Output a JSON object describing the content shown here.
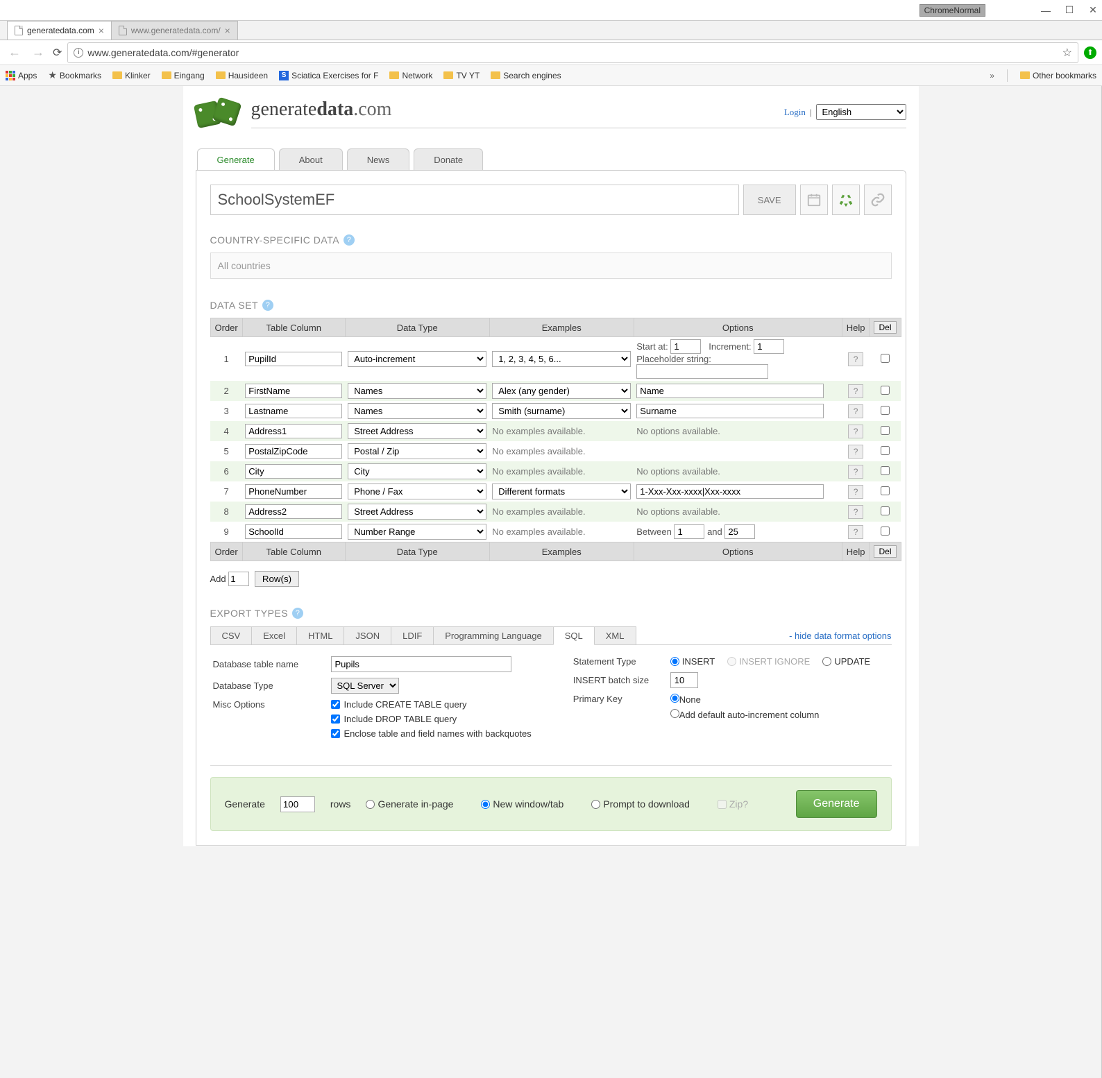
{
  "browser": {
    "badge": "ChromeNormal",
    "tabs": [
      {
        "title": "generatedata.com",
        "active": true
      },
      {
        "title": "www.generatedata.com/",
        "active": false
      }
    ],
    "url": "www.generatedata.com/#generator",
    "bookmarks": {
      "apps": "Apps",
      "bookmarks": "Bookmarks",
      "items": [
        "Klinker",
        "Eingang",
        "Hausideen",
        "Sciatica Exercises for F",
        "Network",
        "TV YT",
        "Search engines"
      ],
      "other": "Other bookmarks"
    }
  },
  "header": {
    "brand1": "generate",
    "brand2": "data",
    "brand3": ".com",
    "login": "Login",
    "lang": "English"
  },
  "main_tabs": [
    "Generate",
    "About",
    "News",
    "Donate"
  ],
  "title_input": "SchoolSystemEF",
  "save_label": "SAVE",
  "sections": {
    "country": "COUNTRY-SPECIFIC DATA",
    "country_value": "All countries",
    "dataset": "DATA SET",
    "export": "EXPORT TYPES"
  },
  "ds_headers": {
    "order": "Order",
    "column": "Table Column",
    "type": "Data Type",
    "examples": "Examples",
    "options": "Options",
    "help": "Help",
    "del": "Del"
  },
  "rows": [
    {
      "n": "1",
      "col": "PupilId",
      "type": "Auto-increment",
      "example": "1, 2, 3, 4, 5, 6...",
      "opts": {
        "kind": "autoinc",
        "start_label": "Start at:",
        "start": "1",
        "incr_label": "Increment:",
        "incr": "1",
        "ph_label": "Placeholder string:",
        "ph": ""
      }
    },
    {
      "n": "2",
      "col": "FirstName",
      "type": "Names",
      "example": "Alex (any gender)",
      "opts": {
        "kind": "text",
        "value": "Name"
      }
    },
    {
      "n": "3",
      "col": "Lastname",
      "type": "Names",
      "example": "Smith (surname)",
      "opts": {
        "kind": "text",
        "value": "Surname"
      }
    },
    {
      "n": "4",
      "col": "Address1",
      "type": "Street Address",
      "example": null,
      "opts": {
        "kind": "none"
      }
    },
    {
      "n": "5",
      "col": "PostalZipCode",
      "type": "Postal / Zip",
      "example": null,
      "opts": {
        "kind": "blank"
      }
    },
    {
      "n": "6",
      "col": "City",
      "type": "City",
      "example": null,
      "opts": {
        "kind": "none"
      }
    },
    {
      "n": "7",
      "col": "PhoneNumber",
      "type": "Phone / Fax",
      "example": "Different formats",
      "opts": {
        "kind": "text",
        "value": "1-Xxx-Xxx-xxxx|Xxx-xxxx"
      }
    },
    {
      "n": "8",
      "col": "Address2",
      "type": "Street Address",
      "example": null,
      "opts": {
        "kind": "none"
      }
    },
    {
      "n": "9",
      "col": "SchoolId",
      "type": "Number Range",
      "example": null,
      "opts": {
        "kind": "range",
        "between": "Between",
        "from": "1",
        "and": "and",
        "to": "25"
      }
    }
  ],
  "no_examples": "No examples available.",
  "no_options": "No options available.",
  "addrow": {
    "add": "Add",
    "count": "1",
    "rows": "Row(s)"
  },
  "export_tabs": [
    "CSV",
    "Excel",
    "HTML",
    "JSON",
    "LDIF",
    "Programming Language",
    "SQL",
    "XML"
  ],
  "export_active": "SQL",
  "hide_link": "- hide data format options",
  "sql": {
    "table_label": "Database table name",
    "table": "Pupils",
    "dbtype_label": "Database Type",
    "dbtype": "SQL Server",
    "misc_label": "Misc Options",
    "misc": [
      "Include CREATE TABLE query",
      "Include DROP TABLE query",
      "Enclose table and field names with backquotes"
    ],
    "stmt_label": "Statement Type",
    "stmt": [
      "INSERT",
      "INSERT IGNORE",
      "UPDATE"
    ],
    "batch_label": "INSERT batch size",
    "batch": "10",
    "pk_label": "Primary Key",
    "pk": [
      "None",
      "Add default auto-increment column"
    ]
  },
  "gen": {
    "generate": "Generate",
    "count": "100",
    "rows": "rows",
    "opts": [
      "Generate in-page",
      "New window/tab",
      "Prompt to download",
      "Zip?"
    ],
    "button": "Generate"
  }
}
